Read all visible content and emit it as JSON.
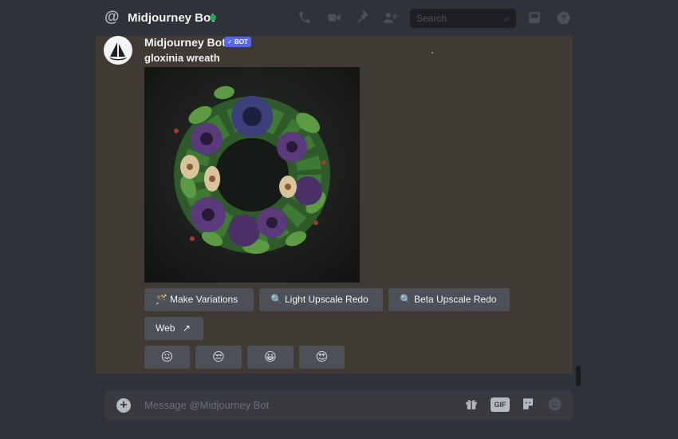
{
  "header": {
    "channel_name": "Midjourney Bot",
    "status_color": "#23a55a",
    "search_placeholder": "Search",
    "icons": [
      "at-icon",
      "phone-icon",
      "video-icon",
      "pin-icon",
      "add-friend-icon",
      "search-icon",
      "inbox-icon",
      "help-icon"
    ]
  },
  "message": {
    "author": "Midjourney Bot",
    "badge": "✓ BOT",
    "prompt": "gloxinia wreath",
    "image_subject": "gloxinia-wreath-image"
  },
  "buttons": [
    {
      "label": "Make Variations",
      "icon": "sparkle-wand-icon",
      "glyph": "🪄"
    },
    {
      "label": "Light Upscale Redo",
      "icon": "magnifier-icon",
      "glyph": "🔍"
    },
    {
      "label": "Beta Upscale Redo",
      "icon": "magnifier-icon",
      "glyph": "🔍"
    },
    {
      "label": "Web",
      "icon": "external-link-icon",
      "glyph": "↗"
    }
  ],
  "reactions": [
    {
      "emoji": "😖",
      "name": "confounded-emoji"
    },
    {
      "emoji": "😒",
      "name": "unamused-emoji"
    },
    {
      "emoji": "😀",
      "name": "grinning-emoji"
    },
    {
      "emoji": "😍",
      "name": "heart-eyes-emoji"
    }
  ],
  "composer": {
    "placeholder": "Message @Midjourney Bot",
    "gif_label": "GIF",
    "icons": [
      "add-attachment-icon",
      "gift-icon",
      "gif-icon",
      "sticker-icon",
      "emoji-icon"
    ]
  },
  "colors": {
    "bot_badge": "#5865f2",
    "button_bg": "#4e5058",
    "chat_bg": "#403a34"
  }
}
